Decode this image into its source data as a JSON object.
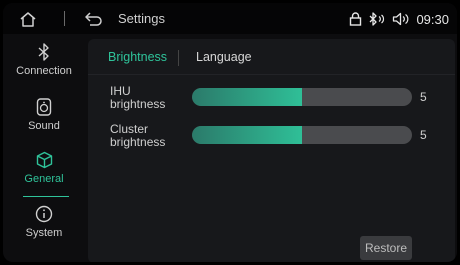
{
  "header": {
    "title": "Settings",
    "time": "09:30",
    "icons": [
      "home-icon",
      "back-icon",
      "lock-icon",
      "bluetooth-audio-icon",
      "volume-icon"
    ]
  },
  "sidebar": {
    "items": [
      {
        "label": "Connection",
        "icon": "bluetooth-icon"
      },
      {
        "label": "Sound",
        "icon": "speaker-icon"
      },
      {
        "label": "General",
        "icon": "cube-icon",
        "active": true
      },
      {
        "label": "System",
        "icon": "info-icon"
      }
    ]
  },
  "tabs": [
    {
      "label": "Brightness",
      "active": true
    },
    {
      "label": "Language",
      "active": false
    }
  ],
  "brightness": {
    "ihu": {
      "label_line1": "IHU",
      "label_line2": "brightness",
      "value": "5",
      "level_fraction": 0.5
    },
    "cluster": {
      "label_line1": "Cluster",
      "label_line2": "brightness",
      "value": "5",
      "level_fraction": 0.5
    }
  },
  "restore_label": "Restore",
  "colors": {
    "accent": "#2fc39a",
    "panel": "#17181b",
    "track": "#4a4b4e"
  }
}
